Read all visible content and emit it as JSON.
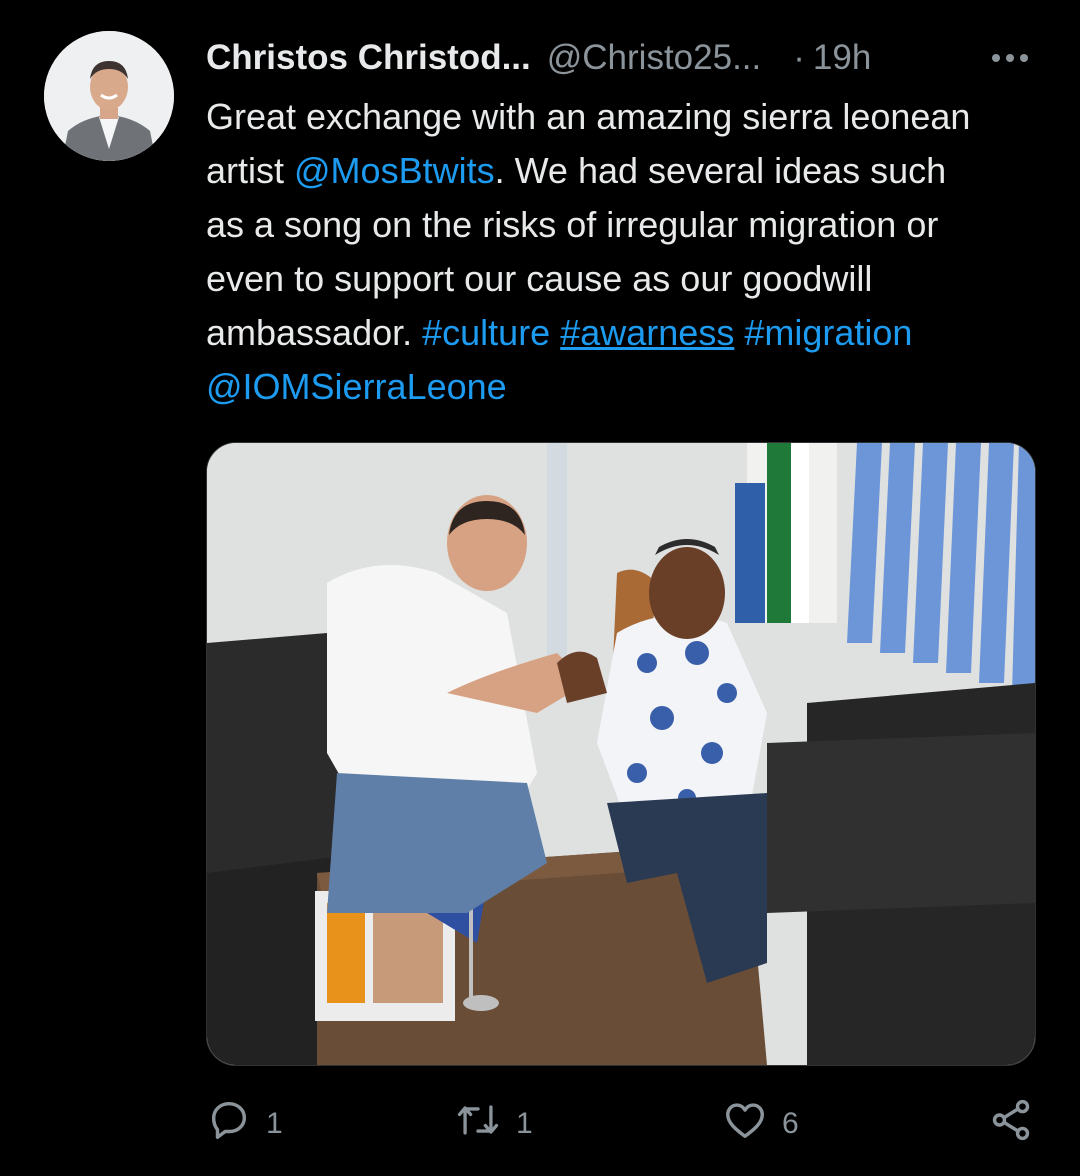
{
  "tweet": {
    "author_name": "Christos Christod...",
    "author_handle": "@Christo25...",
    "separator": "·",
    "time": "19h",
    "text": {
      "part1": "Great exchange with an amazing sierra leonean\nartist ",
      "mention1": "@MosBtwits",
      "part2": ". We had several ideas such\nas a song on the risks of irregular migration or\neven to support our cause as our goodwill\nambassador. ",
      "hashtag1": "#culture",
      "space1": " ",
      "hashtag2": "#awarness",
      "space2": " ",
      "hashtag3": "#migration",
      "part3": "\n",
      "mention2": "@IOMSierraLeone"
    }
  },
  "actions": {
    "reply_count": "1",
    "retweet_count": "1",
    "like_count": "6"
  },
  "colors": {
    "background": "#000000",
    "text": "#e7e9ea",
    "secondary": "#8b949a",
    "link": "#1d9bf0"
  },
  "icons": [
    "more-icon",
    "reply-icon",
    "retweet-icon",
    "like-icon",
    "share-icon"
  ]
}
